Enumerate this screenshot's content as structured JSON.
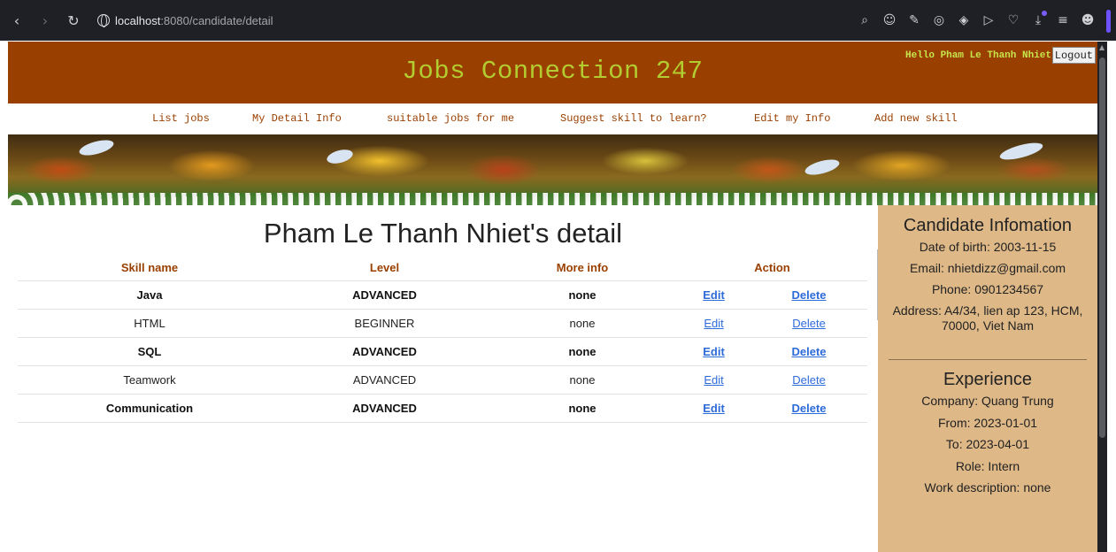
{
  "browser": {
    "url_host": "localhost",
    "url_rest": ":8080/candidate/detail"
  },
  "header": {
    "site_title": "Jobs Connection 247",
    "greeting": "Hello Pham Le Thanh Nhiet",
    "logout_label": "Logout"
  },
  "nav": {
    "items": [
      "List jobs",
      "My Detail Info",
      "suitable jobs for me",
      "Suggest skill to learn?",
      "Edit my Info",
      "Add new skill"
    ]
  },
  "main": {
    "title": "Pham Le Thanh Nhiet's detail",
    "columns": [
      "Skill name",
      "Level",
      "More info",
      "Action"
    ],
    "rows": [
      {
        "name": "Java",
        "level": "ADVANCED",
        "info": "none",
        "edit": "Edit",
        "delete": "Delete",
        "bold": true
      },
      {
        "name": "HTML",
        "level": "BEGINNER",
        "info": "none",
        "edit": "Edit",
        "delete": "Delete",
        "bold": false
      },
      {
        "name": "SQL",
        "level": "ADVANCED",
        "info": "none",
        "edit": "Edit",
        "delete": "Delete",
        "bold": true
      },
      {
        "name": "Teamwork",
        "level": "ADVANCED",
        "info": "none",
        "edit": "Edit",
        "delete": "Delete",
        "bold": false
      },
      {
        "name": "Communication",
        "level": "ADVANCED",
        "info": "none",
        "edit": "Edit",
        "delete": "Delete",
        "bold": true
      }
    ]
  },
  "sidebar": {
    "title": "Candidate Infomation",
    "dob": "Date of birth: 2003-11-15",
    "email": "Email: nhietdizz@gmail.com",
    "phone": "Phone: 0901234567",
    "address": "Address: A4/34, lien ap 123, HCM, 70000, Viet Nam",
    "experience_title": "Experience",
    "company": "Company: Quang Trung",
    "from": "From: 2023-01-01",
    "to": "To: 2023-04-01",
    "role": "Role: Intern",
    "work_description": "Work description: none"
  },
  "colors": {
    "header_bg": "#993f00",
    "title_color": "#b3cc30",
    "sidebar_bg": "#deb887",
    "link": "#2d6bd9"
  }
}
